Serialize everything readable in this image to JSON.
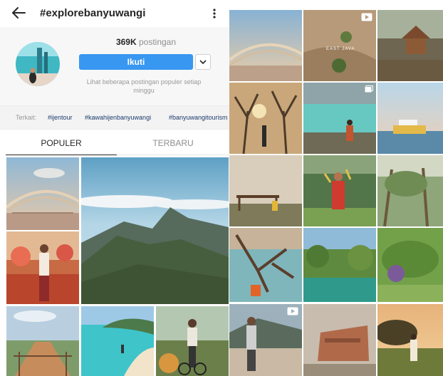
{
  "header": {
    "tag": "#explorebanyuwangi",
    "post_count": "369K",
    "post_label": "postingan",
    "follow_label": "Ikuti",
    "popular_note": "Lihat beberapa postingan populer setiap minggu"
  },
  "related": {
    "label": "Terkait:",
    "tags": [
      "#ijentour",
      "#kawahijenbanyuwangi",
      "#banyuwangitourism"
    ]
  },
  "tabs": {
    "popular": "POPULER",
    "recent": "TERBARU"
  },
  "overlays": {
    "east_java": "EAST JAVA"
  },
  "icons": {
    "back": "arrow-left-icon",
    "more": "more-vertical-icon",
    "dropdown": "chevron-down-icon",
    "video": "video-icon",
    "multi": "multiple-photos-icon"
  },
  "colors": {
    "follow_button": "#3897f0",
    "related_tag": "#1c3b6e"
  }
}
